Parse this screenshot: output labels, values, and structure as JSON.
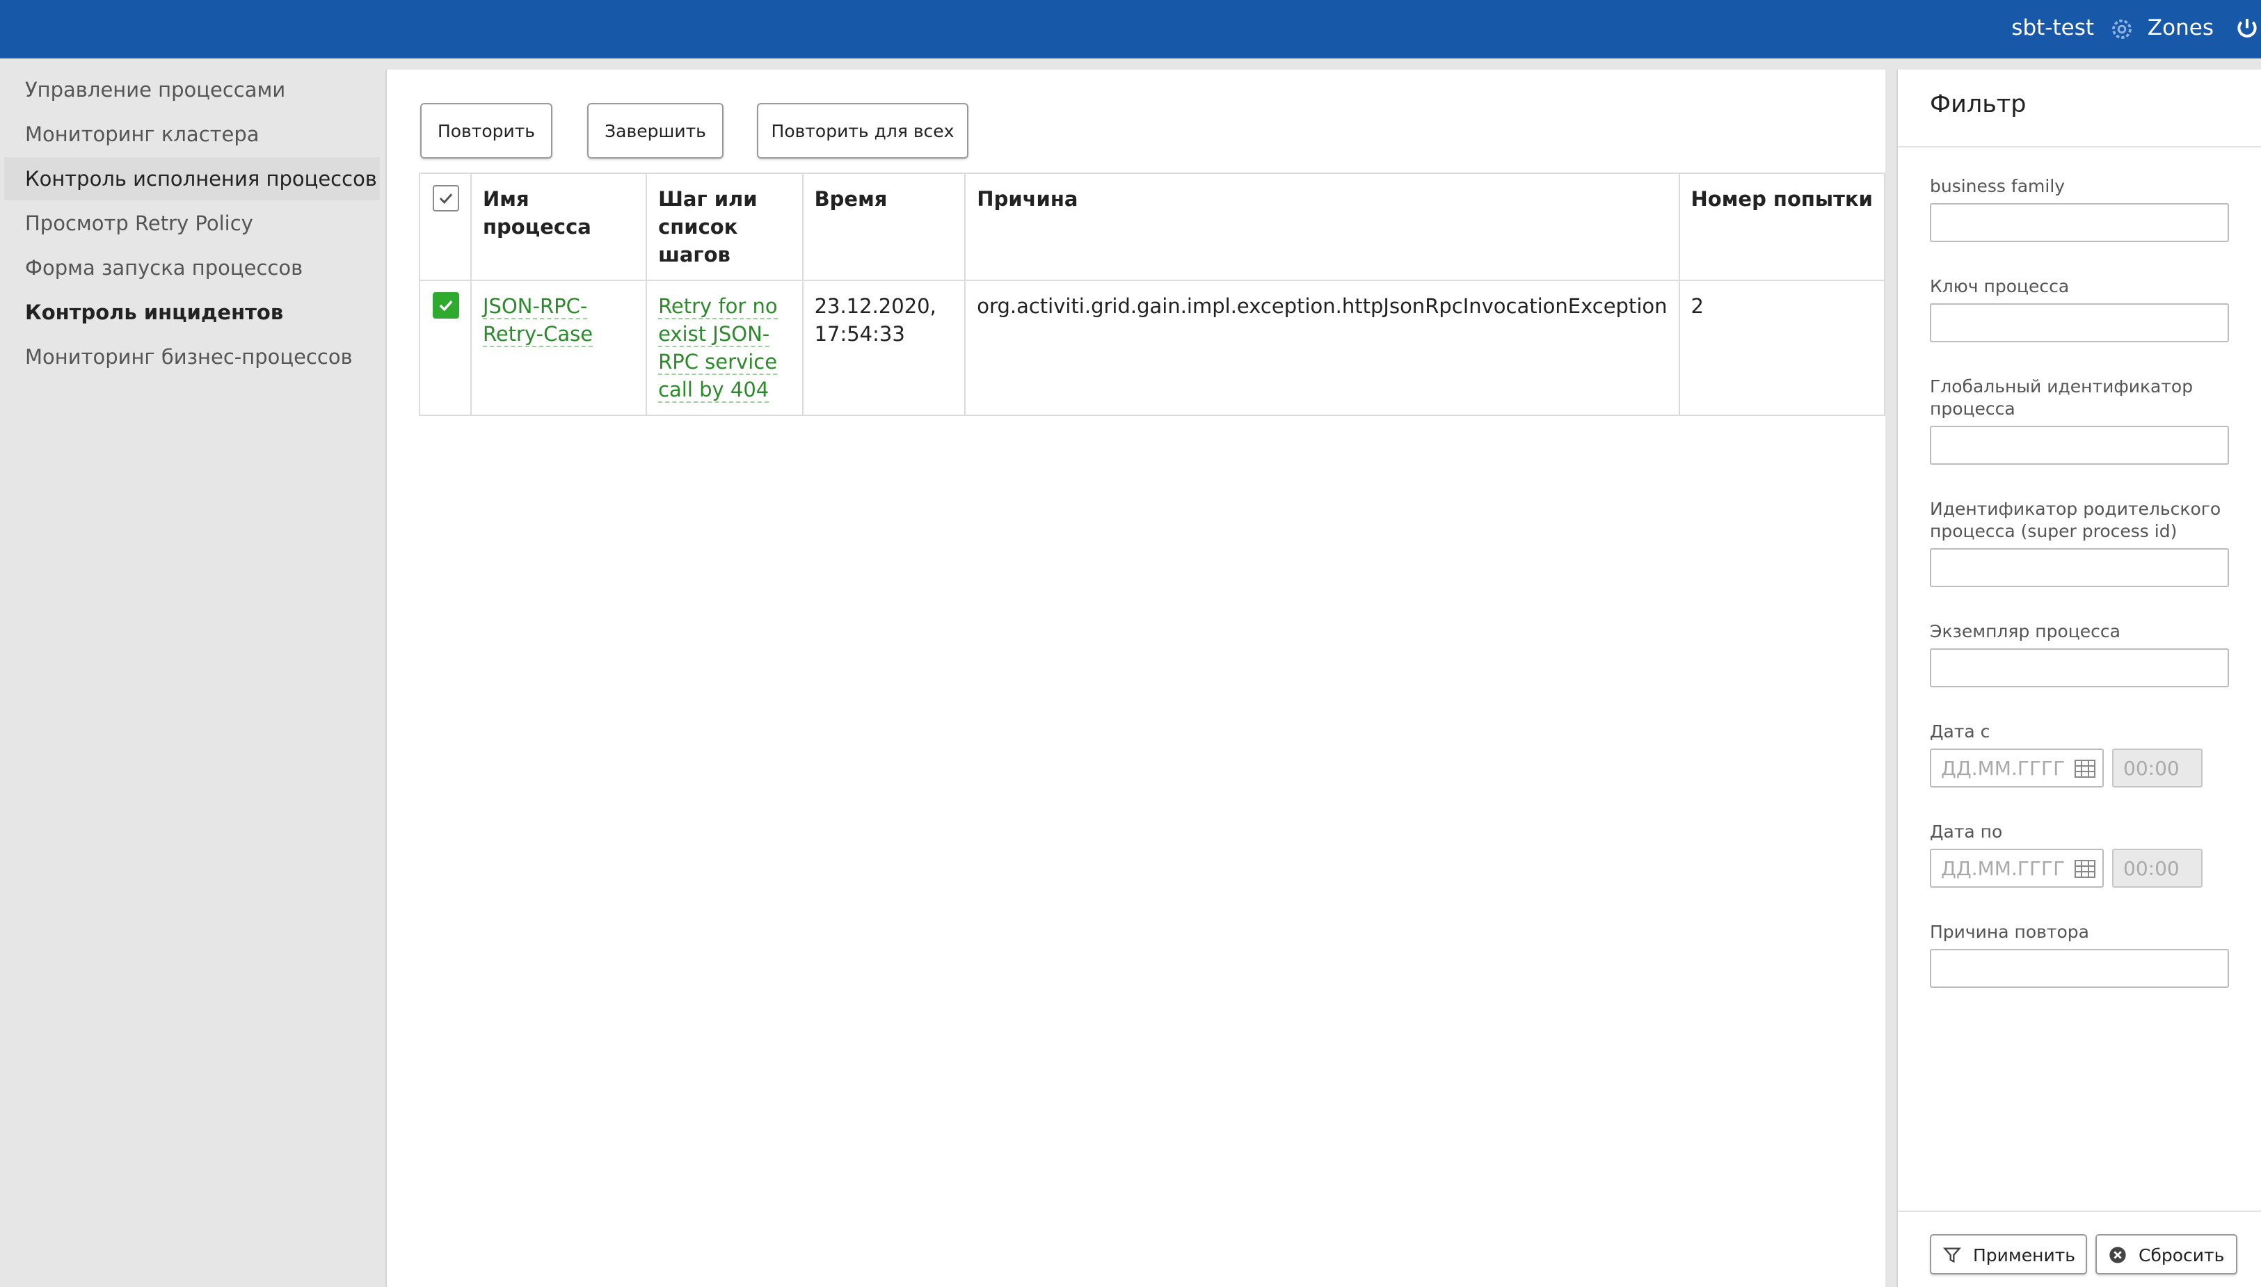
{
  "header": {
    "user": "sbt-test",
    "zones_label": "Zones",
    "gear_icon": "gear-icon",
    "logout_icon": "logout-icon"
  },
  "sidebar": {
    "items": [
      {
        "label": "Управление процессами"
      },
      {
        "label": "Мониторинг кластера"
      },
      {
        "label": "Контроль исполнения процессов"
      },
      {
        "label": "Просмотр Retry Policy"
      },
      {
        "label": "Форма запуска процессов"
      },
      {
        "label": "Контроль инцидентов"
      },
      {
        "label": "Мониторинг бизнес-процессов"
      }
    ]
  },
  "toolbar": {
    "retry_label": "Повторить",
    "finish_label": "Завершить",
    "retry_all_label": "Повторить для всех"
  },
  "table": {
    "headers": [
      "Имя процесса",
      "Шаг или список шагов",
      "Время",
      "Причина",
      "Номер попытки"
    ],
    "rows": [
      {
        "checked": true,
        "process_name": "JSON-RPC-Retry-Case",
        "step": "Retry for no exist JSON-RPC service call by 404",
        "time": "23.12.2020, 17:54:33",
        "reason": "org.activiti.grid.gain.impl.exception.httpJsonRpcInvocationException",
        "attempt": "2"
      }
    ]
  },
  "filter": {
    "title": "Фильтр",
    "fields": {
      "business_family": "business family",
      "process_key": "Ключ процесса",
      "global_id": "Глобальный идентификатор процесса",
      "parent_id": "Идентификатор родительского процесса (super process id)",
      "instance": "Экземпляр процесса",
      "date_from": "Дата с",
      "date_to": "Дата по",
      "retry_reason": "Причина повтора"
    },
    "date_placeholder": "ДД.ММ.ГГГГ",
    "time_placeholder": "00:00",
    "apply_label": "Применить",
    "reset_label": "Сбросить"
  },
  "colors": {
    "header_bg": "#1758a8",
    "link_green": "#2c8a2c",
    "checkbox_green": "#2eaa2e"
  }
}
